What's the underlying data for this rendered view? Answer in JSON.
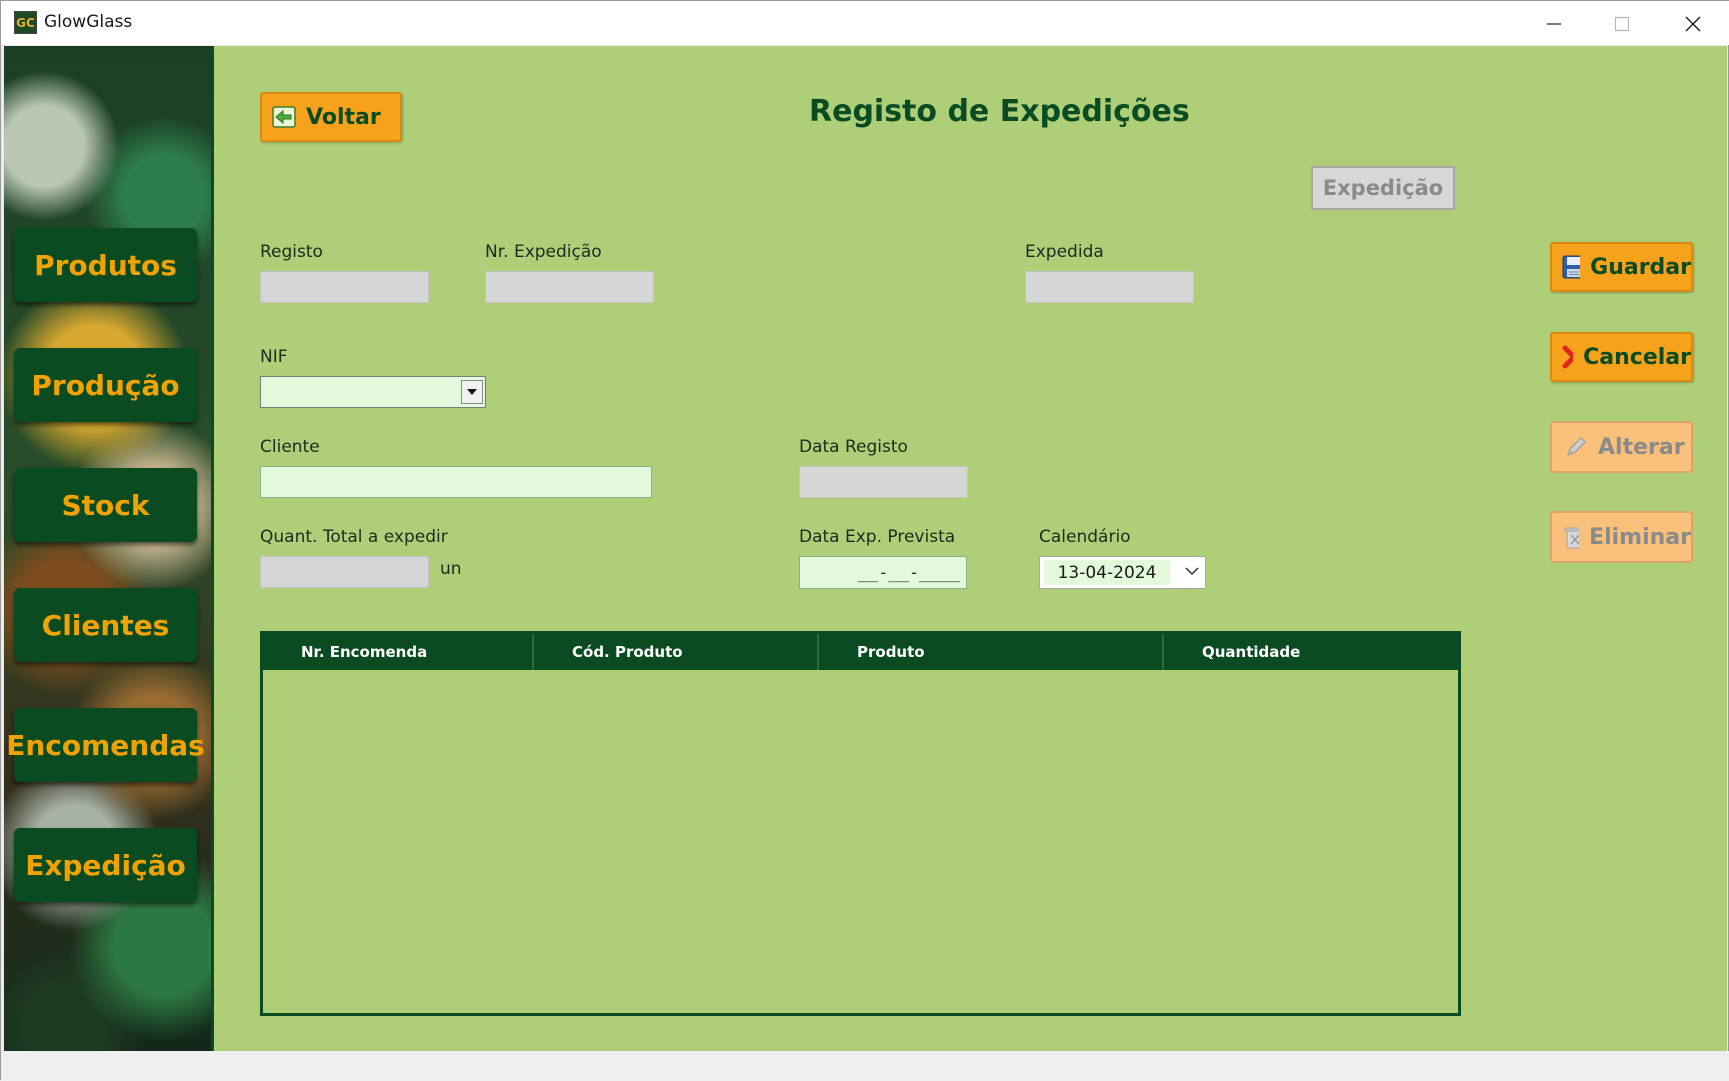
{
  "window": {
    "title": "GlowGlass",
    "app_icon": "GC"
  },
  "sidebar": {
    "items": [
      {
        "label": "Produtos"
      },
      {
        "label": "Produção"
      },
      {
        "label": "Stock"
      },
      {
        "label": "Clientes"
      },
      {
        "label": "Encomendas"
      },
      {
        "label": "Expedição"
      }
    ]
  },
  "header": {
    "back_label": "Voltar",
    "title": "Registo de Expedições",
    "mode_button": "Expedição"
  },
  "form": {
    "registo": {
      "label": "Registo",
      "value": ""
    },
    "nr_expedicao": {
      "label": "Nr. Expedição",
      "value": ""
    },
    "expedida": {
      "label": "Expedida",
      "value": ""
    },
    "nif": {
      "label": "NIF",
      "value": ""
    },
    "cliente": {
      "label": "Cliente",
      "value": ""
    },
    "data_registo": {
      "label": "Data Registo",
      "value": ""
    },
    "quant_total": {
      "label": "Quant. Total a expedir",
      "value": "",
      "unit": "un"
    },
    "data_exp_prevista": {
      "label": "Data Exp. Prevista",
      "value": "__-__-____"
    },
    "calendario": {
      "label": "Calendário",
      "value": "13-04-2024"
    }
  },
  "actions": {
    "guardar": "Guardar",
    "cancelar": "Cancelar",
    "alterar": "Alterar",
    "eliminar": "Eliminar"
  },
  "table": {
    "columns": [
      "Nr. Encomenda",
      "Cód. Produto",
      "Produto",
      "Quantidade"
    ],
    "rows": []
  },
  "colors": {
    "background": "#aecf78",
    "accent_dark_green": "#0b4b22",
    "button_orange": "#f6a21a",
    "field_editable": "#e2f9dc",
    "field_readonly": "#d6d6d6"
  },
  "icons": {
    "back": "arrow-left-icon",
    "save": "floppy-disk-icon",
    "cancel": "red-x-icon",
    "edit": "pencil-icon",
    "delete": "trash-icon"
  }
}
